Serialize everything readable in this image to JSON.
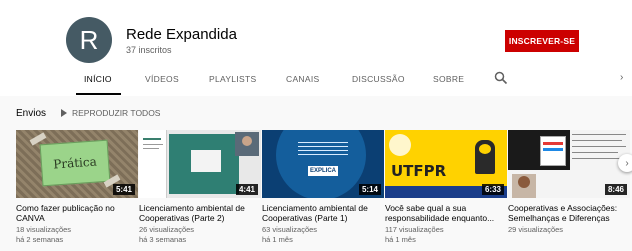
{
  "channel": {
    "avatar_letter": "R",
    "name": "Rede Expandida",
    "subscribers": "37 inscritos",
    "subscribe_label": "INSCREVER-SE"
  },
  "tabs": [
    {
      "label": "INÍCIO",
      "active": true
    },
    {
      "label": "VÍDEOS",
      "active": false
    },
    {
      "label": "PLAYLISTS",
      "active": false
    },
    {
      "label": "CANAIS",
      "active": false
    },
    {
      "label": "DISCUSSÃO",
      "active": false
    },
    {
      "label": "SOBRE",
      "active": false
    }
  ],
  "section": {
    "title": "Envios",
    "play_all": "REPRODUZIR TODOS"
  },
  "videos": [
    {
      "title": "Como fazer publicação no CANVA",
      "views": "18 visualizações",
      "age": "há 2 semanas",
      "duration": "5:41",
      "thumb_text": "Prática"
    },
    {
      "title": "Licenciamento ambiental de Cooperativas (Parte 2)",
      "views": "26 visualizações",
      "age": "há 3 semanas",
      "duration": "4:41"
    },
    {
      "title": "Licenciamento ambiental de Cooperativas (Parte 1)",
      "views": "63 visualizações",
      "age": "há 1 mês",
      "duration": "5:14",
      "thumb_text": "EXPLICA"
    },
    {
      "title": "Você sabe qual a sua responsabilidade enquanto...",
      "views": "117 visualizações",
      "age": "há 1 mês",
      "duration": "6:33",
      "thumb_text": "UTFPR"
    },
    {
      "title": "Cooperativas e Associações: Semelhanças e Diferenças",
      "views": "29 visualizações",
      "age": "há 1 mês",
      "duration": "8:46"
    }
  ],
  "icons": {
    "search": "search-icon",
    "next": "chevron-right-icon"
  },
  "colors": {
    "subscribe": "#cc0000",
    "avatar": "#455a64"
  }
}
